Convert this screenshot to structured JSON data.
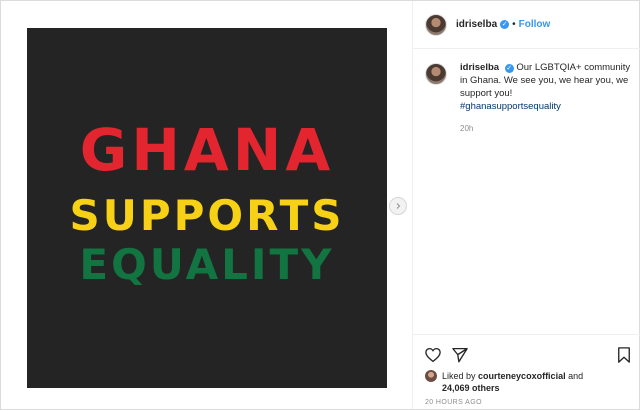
{
  "post": {
    "poster": {
      "line1": "GHANA",
      "line2": "SUPPORTS",
      "line3": "EQUALITY",
      "colors": {
        "background": "#242424",
        "red": "#e2252f",
        "yellow": "#f7d116",
        "green": "#127541"
      }
    },
    "carousel_next_icon": "chevron-right-icon"
  },
  "header": {
    "username": "idriselba",
    "verified_icon": "verified-badge-icon",
    "separator": "•",
    "follow_label": "Follow",
    "accent": "#3897f0"
  },
  "caption": {
    "username": "idriselba",
    "text": "Our LGBTQIA+ community in Ghana. We see you, we hear you, we support you!",
    "hashtag": "#ghanasupportsequality",
    "time": "20h"
  },
  "actions": {
    "icons": [
      "heart-icon",
      "share-icon",
      "bookmark-icon"
    ],
    "liked_by_prefix": "Liked by",
    "liked_by_user": "courteneycoxofficial",
    "liked_by_and": "and",
    "others_count": "24,069 others",
    "time_ago": "20 HOURS AGO"
  }
}
